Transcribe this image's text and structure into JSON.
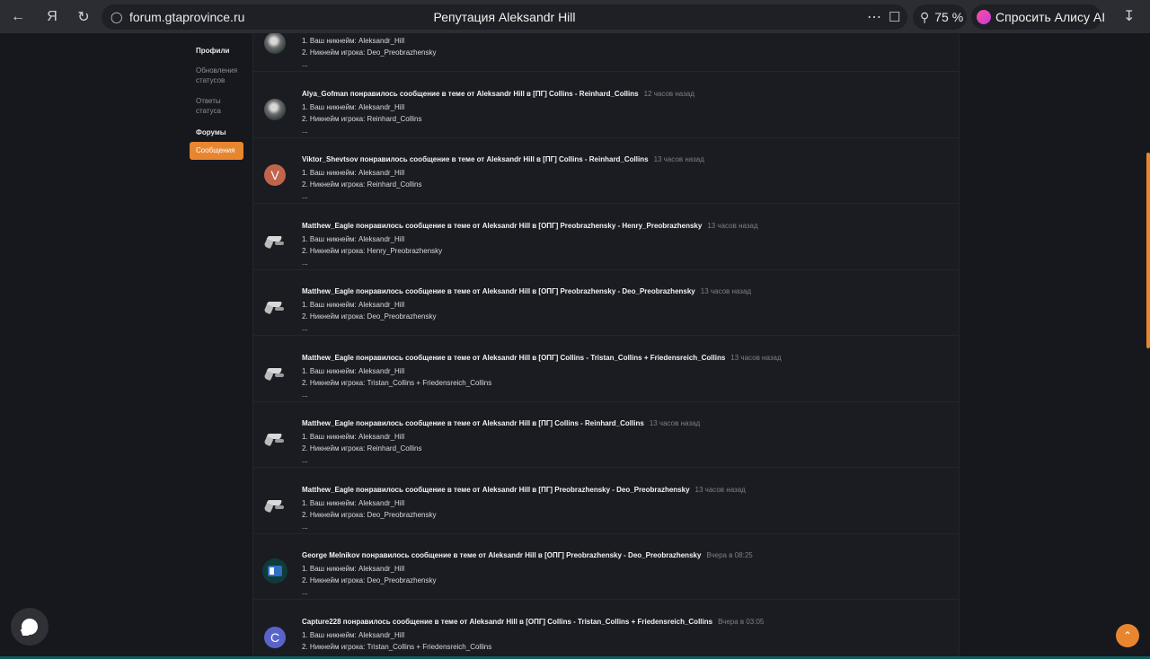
{
  "browser": {
    "url": "forum.gtaprovince.ru",
    "title": "Репутация Aleksandr Hill",
    "zoom": "75 %",
    "alice_label": "Спросить Алису AI"
  },
  "sidebar": {
    "profiles_heading": "Профили",
    "status_updates": "Обновления статусов",
    "status_replies": "Ответы статуса",
    "forums_heading": "Форумы",
    "messages": "Сообщения"
  },
  "items": [
    {
      "avatar": "photo",
      "author": "",
      "text": "",
      "time": "",
      "line1": "1. Ваш никнейм: Aleksandr_Hill",
      "line2": "2. Никнейм игрока: Deo_Preobrazhensky",
      "line3": "..."
    },
    {
      "avatar": "photo",
      "text": "Alya_Gofman понравилось сообщение в теме от Aleksandr Hill в [ПГ] Collins - Reinhard_Collins",
      "time": "12 часов назад",
      "line1": "1. Ваш никнейм: Aleksandr_Hill",
      "line2": "2. Никнейм игрока: Reinhard_Collins",
      "line3": "..."
    },
    {
      "avatar": "V",
      "text": "Viktor_Shevtsov понравилось сообщение в теме от Aleksandr Hill в [ПГ] Collins - Reinhard_Collins",
      "time": "13 часов назад",
      "line1": "1. Ваш никнейм: Aleksandr_Hill",
      "line2": "2. Никнейм игрока: Reinhard_Collins",
      "line3": "..."
    },
    {
      "avatar": "eagle",
      "text": "Matthew_Eagle понравилось сообщение в теме от Aleksandr Hill в [ОПГ] Preobrazhensky - Henry_Preobrazhensky",
      "time": "13 часов назад",
      "line1": "1. Ваш никнейм: Aleksandr_Hill",
      "line2": "2. Никнейм игрока: Henry_Preobrazhensky",
      "line3": "..."
    },
    {
      "avatar": "eagle",
      "text": "Matthew_Eagle понравилось сообщение в теме от Aleksandr Hill в [ОПГ] Preobrazhensky - Deo_Preobrazhensky",
      "time": "13 часов назад",
      "line1": "1. Ваш никнейм: Aleksandr_Hill",
      "line2": "2. Никнейм игрока: Deo_Preobrazhensky",
      "line3": "..."
    },
    {
      "avatar": "eagle",
      "text": "Matthew_Eagle понравилось сообщение в теме от Aleksandr Hill в [ОПГ] Collins - Tristan_Collins + Friedensreich_Collins",
      "time": "13 часов назад",
      "line1": "1. Ваш никнейм: Aleksandr_Hill",
      "line2": "2. Никнейм игрока: Tristan_Collins + Friedensreich_Collins",
      "line3": "..."
    },
    {
      "avatar": "eagle",
      "text": "Matthew_Eagle понравилось сообщение в теме от Aleksandr Hill в [ПГ] Collins - Reinhard_Collins",
      "time": "13 часов назад",
      "line1": "1. Ваш никнейм: Aleksandr_Hill",
      "line2": "2. Никнейм игрока: Reinhard_Collins",
      "line3": "..."
    },
    {
      "avatar": "eagle",
      "text": "Matthew_Eagle понравилось сообщение в теме от Aleksandr Hill в [ПГ] Preobrazhensky - Deo_Preobrazhensky",
      "time": "13 часов назад",
      "line1": "1. Ваш никнейм: Aleksandr_Hill",
      "line2": "2. Никнейм игрока: Deo_Preobrazhensky",
      "line3": "..."
    },
    {
      "avatar": "george",
      "text": "George Melnikov понравилось сообщение в теме от Aleksandr Hill в [ОПГ] Preobrazhensky - Deo_Preobrazhensky",
      "time": "Вчера в 08:25",
      "line1": "1. Ваш никнейм: Aleksandr_Hill",
      "line2": "2. Никнейм игрока: Deo_Preobrazhensky",
      "line3": "..."
    },
    {
      "avatar": "C",
      "text": "Capture228 понравилось сообщение в теме от Aleksandr Hill в [ОПГ] Collins - Tristan_Collins + Friedensreich_Collins",
      "time": "Вчера в 03:05",
      "line1": "1. Ваш никнейм: Aleksandr_Hill",
      "line2": "2. Никнейм игрока: Tristan_Collins + Friedensreich_Collins",
      "line3": "..."
    }
  ],
  "accent": "#e88630"
}
